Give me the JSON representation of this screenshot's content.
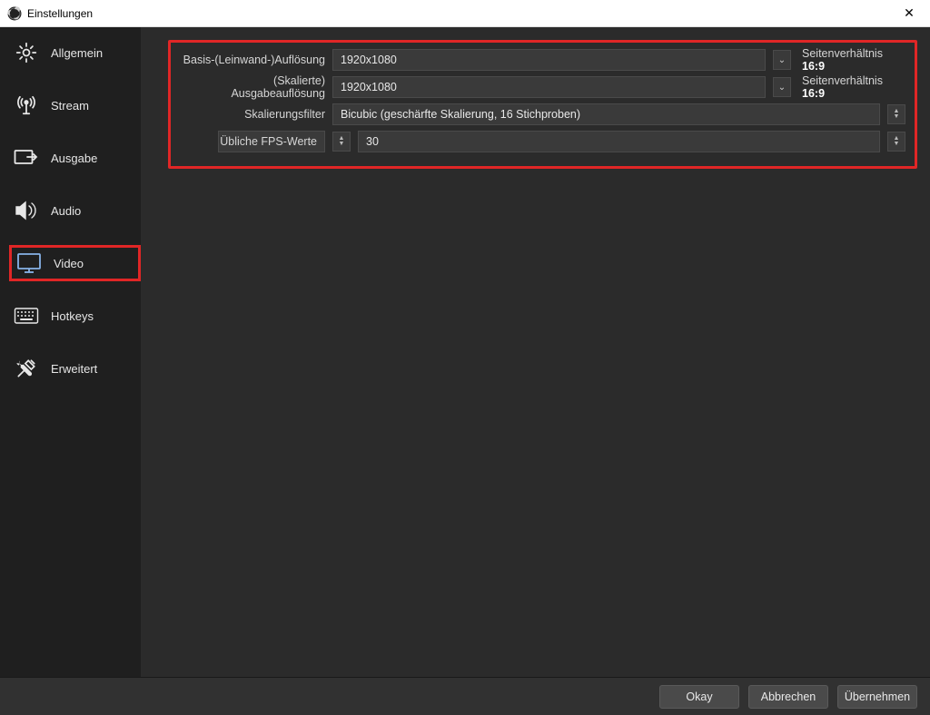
{
  "window": {
    "title": "Einstellungen"
  },
  "sidebar": {
    "items": [
      {
        "label": "Allgemein"
      },
      {
        "label": "Stream"
      },
      {
        "label": "Ausgabe"
      },
      {
        "label": "Audio"
      },
      {
        "label": "Video"
      },
      {
        "label": "Hotkeys"
      },
      {
        "label": "Erweitert"
      }
    ]
  },
  "video": {
    "base_label": "Basis-(Leinwand-)Auflösung",
    "base_value": "1920x1080",
    "base_aspect_prefix": "Seitenverhältnis",
    "base_aspect_value": "16:9",
    "output_label": "(Skalierte) Ausgabeauflösung",
    "output_value": "1920x1080",
    "output_aspect_prefix": "Seitenverhältnis",
    "output_aspect_value": "16:9",
    "filter_label": "Skalierungsfilter",
    "filter_value": "Bicubic (geschärfte Skalierung, 16 Stichproben)",
    "fps_type_label": "Übliche FPS-Werte",
    "fps_value": "30"
  },
  "footer": {
    "ok": "Okay",
    "cancel": "Abbrechen",
    "apply": "Übernehmen"
  }
}
